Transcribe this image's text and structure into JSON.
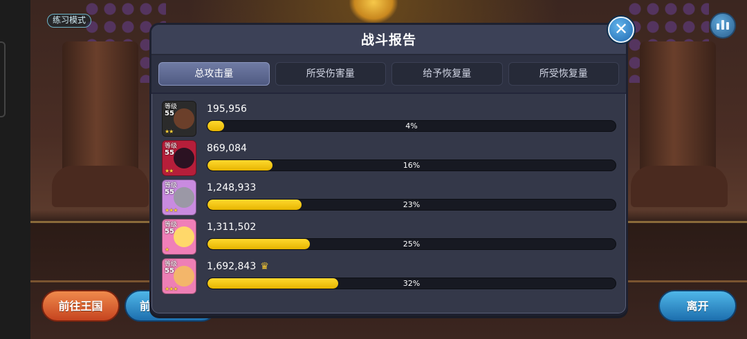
{
  "mode_tag": "练习模式",
  "report": {
    "title": "战斗报告",
    "tabs": [
      {
        "label": "总攻击量",
        "active": true
      },
      {
        "label": "所受伤害量",
        "active": false
      },
      {
        "label": "给予恢复量",
        "active": false
      },
      {
        "label": "所受恢复量",
        "active": false
      }
    ],
    "level_label": "等级",
    "rows": [
      {
        "level": "55",
        "stars": "★★",
        "value": "195,956",
        "percent_text": "4%",
        "percent": 4,
        "top": false,
        "avatar_bg": "#2b2b2b",
        "avatar_face": "#6b3f2a"
      },
      {
        "level": "55",
        "stars": "★★",
        "value": "869,084",
        "percent_text": "16%",
        "percent": 16,
        "top": false,
        "avatar_bg": "#b61e3a",
        "avatar_face": "#2b1222"
      },
      {
        "level": "55",
        "stars": "★★★",
        "value": "1,248,933",
        "percent_text": "23%",
        "percent": 23,
        "top": false,
        "avatar_bg": "#c98be0",
        "avatar_face": "#9b98a6"
      },
      {
        "level": "55",
        "stars": "★",
        "value": "1,311,502",
        "percent_text": "25%",
        "percent": 25,
        "top": false,
        "avatar_bg": "#f07fb8",
        "avatar_face": "#ffd86a"
      },
      {
        "level": "55",
        "stars": "★★★",
        "value": "1,692,843",
        "percent_text": "32%",
        "percent": 32,
        "top": true,
        "avatar_bg": "#ee7fb5",
        "avatar_face": "#f3b66a"
      }
    ]
  },
  "buttons": {
    "kingdom": "前往王国",
    "second": "前",
    "leave": "离开"
  },
  "colors": {
    "bar_fill": "#f2c80f",
    "panel_bg": "#343849",
    "active_tab": "#5f6b94"
  }
}
